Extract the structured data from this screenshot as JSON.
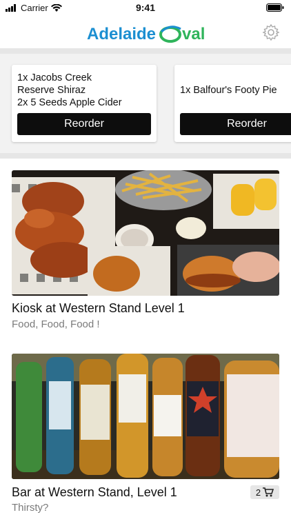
{
  "status_bar": {
    "carrier": "Carrier",
    "time": "9:41"
  },
  "header": {
    "logo_word1": "Adelaide",
    "logo_word2": "val",
    "settings_icon": "gear-icon"
  },
  "recent_orders": [
    {
      "items": [
        "1x Jacobs Creek",
        "Reserve Shiraz",
        "2x 5 Seeds Apple Cider"
      ],
      "button": "Reorder"
    },
    {
      "items": [
        "1x Balfour's Footy Pie"
      ],
      "button": "Reorder"
    }
  ],
  "venues": [
    {
      "name": "Kiosk at Western Stand Level 1",
      "subtitle": "Food, Food, Food !"
    },
    {
      "name": "Bar at Western Stand, Level 1",
      "subtitle": "Thirsty?",
      "cart_count": "2"
    }
  ],
  "colors": {
    "brand_blue": "#1c8fd1",
    "brand_green": "#2fb45b",
    "button_bg": "#0d0d0d"
  }
}
